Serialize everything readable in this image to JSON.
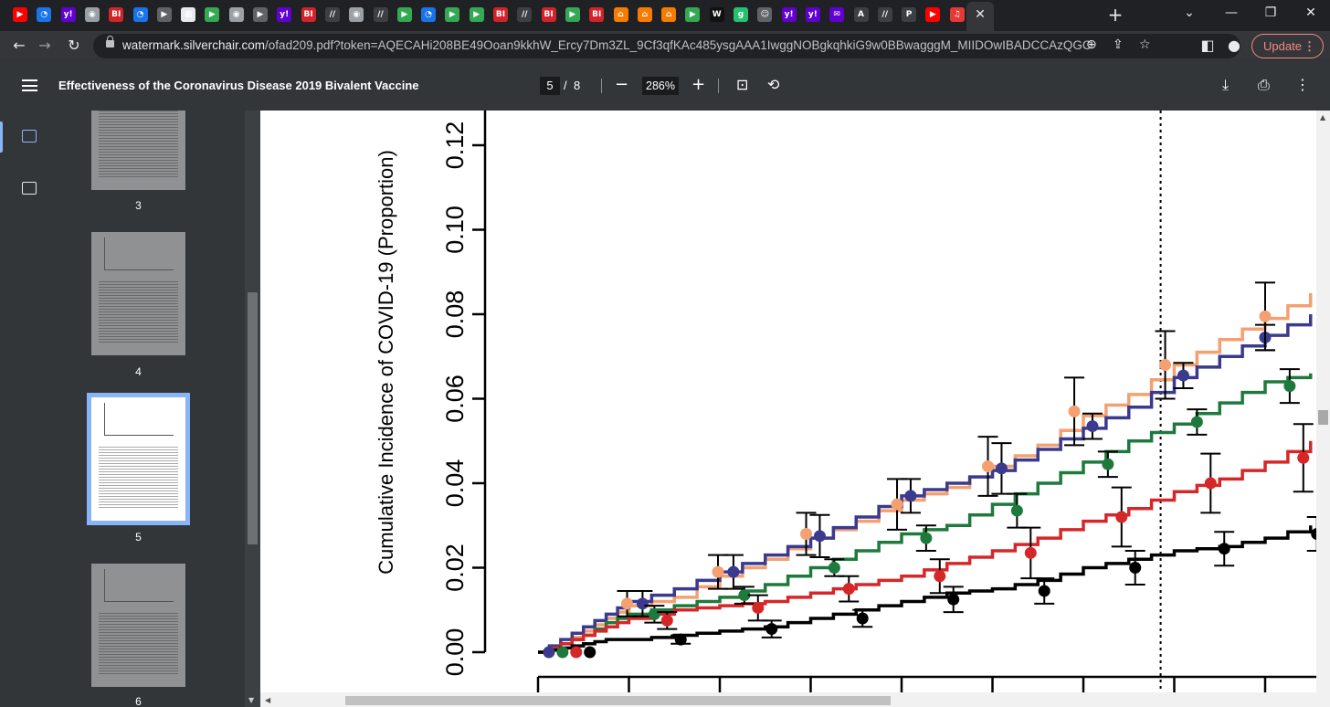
{
  "browser": {
    "tabs": [
      {
        "icon": "youtube-icon",
        "color": "#ff0000",
        "glyph": "▶"
      },
      {
        "icon": "generic-site-icon",
        "color": "#1a73e8",
        "glyph": "◔"
      },
      {
        "icon": "yahoo-icon",
        "color": "#6001d2",
        "glyph": "y!"
      },
      {
        "icon": "globe-icon",
        "color": "#9aa0a6",
        "glyph": "◉"
      },
      {
        "icon": "business-insider-icon",
        "color": "#d2232a",
        "glyph": "BI"
      },
      {
        "icon": "generic-site-icon",
        "color": "#1a73e8",
        "glyph": "◔"
      },
      {
        "icon": "arrow-site-icon",
        "color": "#5f6368",
        "glyph": "▶"
      },
      {
        "icon": "image-site-icon",
        "color": "#e8eaed",
        "glyph": "▦"
      },
      {
        "icon": "play-icon",
        "color": "#34a853",
        "glyph": "▶"
      },
      {
        "icon": "globe-icon",
        "color": "#9aa0a6",
        "glyph": "◉"
      },
      {
        "icon": "arrow-site-icon",
        "color": "#5f6368",
        "glyph": "▶"
      },
      {
        "icon": "yahoo-icon",
        "color": "#6001d2",
        "glyph": "y!"
      },
      {
        "icon": "business-insider-icon",
        "color": "#d2232a",
        "glyph": "BI"
      },
      {
        "icon": "medium-icon",
        "color": "#3c4043",
        "glyph": "//"
      },
      {
        "icon": "globe-icon",
        "color": "#9aa0a6",
        "glyph": "◉"
      },
      {
        "icon": "medium-icon",
        "color": "#3c4043",
        "glyph": "//"
      },
      {
        "icon": "play-icon",
        "color": "#34a853",
        "glyph": "▶"
      },
      {
        "icon": "generic-site-icon",
        "color": "#1a73e8",
        "glyph": "◔"
      },
      {
        "icon": "play-icon",
        "color": "#34a853",
        "glyph": "▶"
      },
      {
        "icon": "play-icon",
        "color": "#34a853",
        "glyph": "▶"
      },
      {
        "icon": "business-insider-icon",
        "color": "#d2232a",
        "glyph": "BI"
      },
      {
        "icon": "medium-icon",
        "color": "#3c4043",
        "glyph": "//"
      },
      {
        "icon": "business-insider-icon",
        "color": "#d2232a",
        "glyph": "BI"
      },
      {
        "icon": "play-icon",
        "color": "#34a853",
        "glyph": "▶"
      },
      {
        "icon": "business-insider-icon",
        "color": "#d2232a",
        "glyph": "BI"
      },
      {
        "icon": "bookmark-icon",
        "color": "#f57c00",
        "glyph": "⌂"
      },
      {
        "icon": "bookmark-icon",
        "color": "#f57c00",
        "glyph": "⌂"
      },
      {
        "icon": "bookmark-icon",
        "color": "#f57c00",
        "glyph": "⌂"
      },
      {
        "icon": "play-icon",
        "color": "#34a853",
        "glyph": "▶"
      },
      {
        "icon": "wsj-icon",
        "color": "#111111",
        "glyph": "W"
      },
      {
        "icon": "g-site-icon",
        "color": "#25c16f",
        "glyph": "g"
      },
      {
        "icon": "profile-site-icon",
        "color": "#5f6368",
        "glyph": "☺"
      },
      {
        "icon": "yahoo-icon",
        "color": "#6001d2",
        "glyph": "y!"
      },
      {
        "icon": "yahoo-icon",
        "color": "#6001d2",
        "glyph": "y!"
      },
      {
        "icon": "yahoo-mail-icon",
        "color": "#6001d2",
        "glyph": "✉"
      },
      {
        "icon": "atlantic-icon",
        "color": "#3c4043",
        "glyph": "A"
      },
      {
        "icon": "medium-icon",
        "color": "#3c4043",
        "glyph": "//"
      },
      {
        "icon": "p-site-icon",
        "color": "#3c4043",
        "glyph": "P"
      },
      {
        "icon": "youtube-icon",
        "color": "#ff0000",
        "glyph": "▶"
      },
      {
        "icon": "podcast-icon",
        "color": "#e53935",
        "glyph": "♫"
      }
    ],
    "url_host": "watermark.silverchair.com",
    "url_path": "/ofad209.pdf?token=AQECAHi208BE49Ooan9kkhW_Ercy7Dm3ZL_9Cf3qfKAc485ysgAAA1IwggNOBgkqhkiG9w0BBwagggM_MIIDOwIBADCCAzQGCSqGSIb3...",
    "update_label": "Update"
  },
  "pdf": {
    "title": "Effectiveness of the Coronavirus Disease 2019 Bivalent Vaccine",
    "current_page": "5",
    "page_sep": "/",
    "total_pages": "8",
    "zoom": "286%"
  },
  "thumbnails": [
    {
      "label": "3"
    },
    {
      "label": "4"
    },
    {
      "label": "5"
    },
    {
      "label": "6"
    }
  ],
  "chart_data": {
    "type": "line",
    "ylabel": "Cumulative Incidence of COVID-19 (Proportion)",
    "ytick_labels": [
      "0.00",
      "0.02",
      "0.04",
      "0.06",
      "0.08",
      "0.10",
      "0.12"
    ],
    "ylim": [
      0,
      0.12
    ],
    "x_ticks": [
      0,
      1,
      2,
      3,
      4,
      5,
      6,
      7,
      8,
      9
    ],
    "vertical_dashed_line_x": 6.85,
    "series": [
      {
        "color": "#f4a070",
        "x": [
          0,
          0.25,
          0.5,
          0.75,
          1,
          1.5,
          2,
          2.5,
          3,
          3.5,
          4,
          4.5,
          5,
          5.5,
          6,
          6.5,
          7,
          7.5,
          8,
          8.5
        ],
        "y": [
          0,
          0.002,
          0.005,
          0.008,
          0.011,
          0.013,
          0.018,
          0.022,
          0.027,
          0.031,
          0.036,
          0.039,
          0.044,
          0.049,
          0.056,
          0.061,
          0.068,
          0.074,
          0.079,
          0.085
        ]
      },
      {
        "color": "#3a3a8f",
        "x": [
          0,
          0.25,
          0.5,
          0.75,
          1,
          1.5,
          2,
          2.5,
          3,
          3.5,
          4,
          4.5,
          5,
          5.5,
          6,
          6.5,
          7,
          7.5,
          8,
          8.5
        ],
        "y": [
          0,
          0.003,
          0.006,
          0.009,
          0.012,
          0.015,
          0.019,
          0.023,
          0.027,
          0.032,
          0.037,
          0.04,
          0.043,
          0.048,
          0.053,
          0.058,
          0.065,
          0.07,
          0.075,
          0.08
        ]
      },
      {
        "color": "#1e7a3c",
        "x": [
          0,
          0.25,
          0.5,
          0.75,
          1,
          1.5,
          2,
          2.5,
          3,
          3.5,
          4,
          4.5,
          5,
          5.5,
          6,
          6.5,
          7,
          7.5,
          8,
          8.5
        ],
        "y": [
          0,
          0.002,
          0.004,
          0.007,
          0.009,
          0.011,
          0.013,
          0.016,
          0.02,
          0.024,
          0.028,
          0.03,
          0.035,
          0.04,
          0.045,
          0.05,
          0.054,
          0.059,
          0.064,
          0.066
        ]
      },
      {
        "color": "#d62728",
        "x": [
          0,
          0.25,
          0.5,
          0.75,
          1,
          1.5,
          2,
          2.5,
          3,
          3.5,
          4,
          4.5,
          5,
          5.5,
          6,
          6.5,
          7,
          7.5,
          8,
          8.5
        ],
        "y": [
          0,
          0.002,
          0.004,
          0.006,
          0.008,
          0.01,
          0.011,
          0.012,
          0.014,
          0.016,
          0.018,
          0.021,
          0.024,
          0.027,
          0.031,
          0.034,
          0.038,
          0.041,
          0.045,
          0.05
        ]
      },
      {
        "color": "#000000",
        "x": [
          0,
          0.25,
          0.5,
          0.75,
          1,
          1.5,
          2,
          2.5,
          3,
          3.5,
          4,
          4.5,
          5,
          5.5,
          6,
          6.5,
          7,
          7.5,
          8,
          8.5
        ],
        "y": [
          0,
          0.001,
          0.002,
          0.003,
          0.003,
          0.004,
          0.005,
          0.006,
          0.008,
          0.01,
          0.012,
          0.014,
          0.015,
          0.017,
          0.02,
          0.022,
          0.024,
          0.025,
          0.027,
          0.03
        ]
      }
    ],
    "points": [
      {
        "color": "#3a3a8f",
        "x": [
          0.12,
          1.15,
          2.15,
          3.1,
          4.1,
          5.1,
          6.1,
          7.1,
          8.0
        ],
        "y": [
          0,
          0.0115,
          0.019,
          0.0275,
          0.037,
          0.0435,
          0.0535,
          0.0655,
          0.0745
        ],
        "err": [
          0,
          0.003,
          0.004,
          0.005,
          0.004,
          0.006,
          0.003,
          0.003,
          0.003
        ]
      },
      {
        "color": "#1e7a3c",
        "x": [
          0.27,
          1.28,
          2.27,
          3.26,
          4.27,
          5.27,
          6.27,
          7.25,
          8.27
        ],
        "y": [
          0,
          0.009,
          0.0135,
          0.02,
          0.027,
          0.0335,
          0.0445,
          0.0545,
          0.063
        ],
        "err": [
          0,
          0.002,
          0.002,
          0.002,
          0.003,
          0.004,
          0.003,
          0.003,
          0.004
        ]
      },
      {
        "color": "#d62728",
        "x": [
          0.42,
          1.42,
          2.42,
          3.42,
          4.42,
          5.42,
          6.42,
          7.4,
          8.42
        ],
        "y": [
          0,
          0.0075,
          0.0105,
          0.015,
          0.018,
          0.0235,
          0.032,
          0.04,
          0.046
        ],
        "err": [
          0,
          0.002,
          0.003,
          0.003,
          0.004,
          0.006,
          0.007,
          0.007,
          0.008
        ]
      },
      {
        "color": "#000000",
        "x": [
          0.57,
          1.57,
          2.57,
          3.57,
          4.57,
          5.57,
          6.57,
          7.55,
          8.57
        ],
        "y": [
          0,
          0.003,
          0.0055,
          0.008,
          0.0125,
          0.0145,
          0.02,
          0.0245,
          0.028
        ],
        "err": [
          0,
          0.001,
          0.002,
          0.002,
          0.003,
          0.003,
          0.004,
          0.004,
          0.004
        ]
      },
      {
        "color": "#f4a070",
        "x": [
          8.0
        ],
        "y": [
          0.0795
        ],
        "err": [
          0.008
        ]
      },
      {
        "color": "#f4a070",
        "x": [
          5.9,
          6.9
        ],
        "y": [
          0.057,
          0.068
        ],
        "err": [
          0.008,
          0.008
        ]
      },
      {
        "color": "#f4a070",
        "x": [
          4.95
        ],
        "y": [
          0.044
        ],
        "err": [
          0.007
        ]
      },
      {
        "color": "#f4a070",
        "x": [
          3.95
        ],
        "y": [
          0.035
        ],
        "err": [
          0.006
        ]
      },
      {
        "color": "#f4a070",
        "x": [
          2.95
        ],
        "y": [
          0.028
        ],
        "err": [
          0.005
        ]
      },
      {
        "color": "#f4a070",
        "x": [
          0.98
        ],
        "y": [
          0.0115
        ],
        "err": [
          0.003
        ]
      },
      {
        "color": "#f4a070",
        "x": [
          1.98
        ],
        "y": [
          0.019
        ],
        "err": [
          0.004
        ]
      }
    ]
  }
}
